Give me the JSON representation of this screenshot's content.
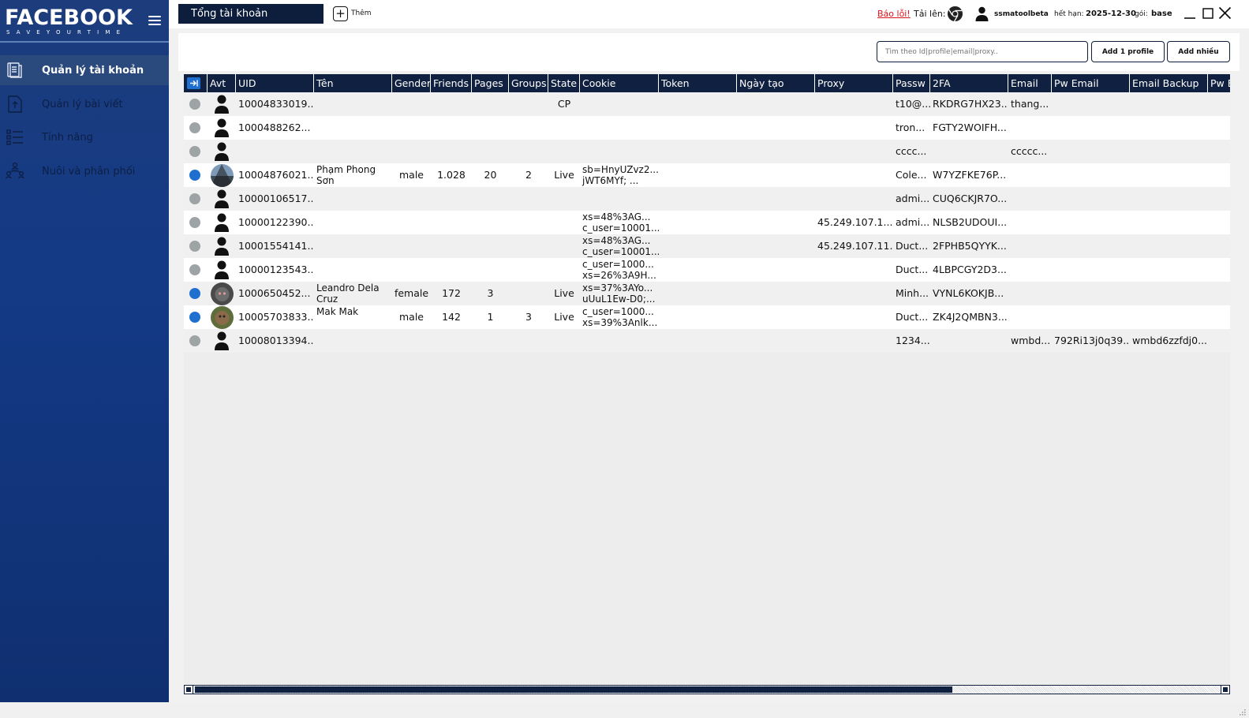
{
  "app": {
    "logo_word": "FACEBOOK",
    "logo_tagline": "SAVEYOURTIME"
  },
  "sidebar": {
    "items": [
      {
        "label": "Quản lý tài khoản",
        "icon": "book-stack-icon",
        "active": true
      },
      {
        "label": "Quản lý bài viết",
        "icon": "upload-document-icon",
        "active": false
      },
      {
        "label": "Tính năng",
        "icon": "checklist-icon",
        "active": false
      },
      {
        "label": "Nuôi và phân phối",
        "icon": "network-people-icon",
        "active": false
      }
    ]
  },
  "topbar": {
    "account_select": "Tổng tài khoản",
    "add_label": "Thêm",
    "report_label": "Báo lỗi!",
    "upload_label": "Tải lên:",
    "username": "ssmatoolbeta",
    "expiry_label": "hết hạn:",
    "expiry_value": "2025-12-30",
    "plan_label": "gói:",
    "plan_value": "base"
  },
  "toolbar": {
    "search_placeholder": "Tìm theo Id|profile|email|proxy..",
    "add_one_label": "Add 1 profile",
    "add_many_label": "Add nhiều"
  },
  "table": {
    "columns": [
      "Avt",
      "UID",
      "Tên",
      "Gender",
      "Friends",
      "Pages",
      "Groups",
      "State",
      "Cookie",
      "Token",
      "Ngày tạo",
      "Proxy",
      "Passw",
      "2FA",
      "Email",
      "Pw Email",
      "Email Backup",
      "Pw E"
    ],
    "rows": [
      {
        "status": "gray",
        "avatar": "default",
        "uid": "10004833019...",
        "name": "",
        "gender": "",
        "friends": "",
        "pages": "",
        "groups": "",
        "state": "CP",
        "cookie": "",
        "token": "",
        "created": "",
        "proxy": "",
        "password": "t10@...",
        "twofa": "RKDRG7HX23...",
        "email": "thang...",
        "pw_email": "",
        "email_backup": "",
        "pw_email_backup": ""
      },
      {
        "status": "gray",
        "avatar": "default",
        "uid": "1000488262...",
        "name": "",
        "gender": "",
        "friends": "",
        "pages": "",
        "groups": "",
        "state": "",
        "cookie": "",
        "token": "",
        "created": "",
        "proxy": "",
        "password": "tron...",
        "twofa": "FGTY2WOIFH...",
        "email": "",
        "pw_email": "",
        "email_backup": "",
        "pw_email_backup": ""
      },
      {
        "status": "gray",
        "avatar": "default",
        "uid": "",
        "name": "",
        "gender": "",
        "friends": "",
        "pages": "",
        "groups": "",
        "state": "",
        "cookie": "",
        "token": "",
        "created": "",
        "proxy": "",
        "password": "cccc...",
        "twofa": "",
        "email": "ccccc...",
        "pw_email": "",
        "email_backup": "",
        "pw_email_backup": ""
      },
      {
        "status": "blue",
        "avatar": "photo-sky",
        "uid": "10004876021...",
        "name": "Phạm Phong Sơn",
        "gender": "male",
        "friends": "1.028",
        "pages": "20",
        "groups": "2",
        "state": "Live",
        "cookie": "sb=HnyUZvz2... jWT6MYf; ...",
        "token": "",
        "created": "",
        "proxy": "",
        "password": "Cole...",
        "twofa": "W7YZFKE76P...",
        "email": "",
        "pw_email": "",
        "email_backup": "",
        "pw_email_backup": ""
      },
      {
        "status": "gray",
        "avatar": "default",
        "uid": "10000106517...",
        "name": "",
        "gender": "",
        "friends": "",
        "pages": "",
        "groups": "",
        "state": "",
        "cookie": "",
        "token": "",
        "created": "",
        "proxy": "",
        "password": "admi...",
        "twofa": "CUQ6CKJR7O...",
        "email": "",
        "pw_email": "",
        "email_backup": "",
        "pw_email_backup": ""
      },
      {
        "status": "gray",
        "avatar": "default",
        "uid": "10000122390...",
        "name": "",
        "gender": "",
        "friends": "",
        "pages": "",
        "groups": "",
        "state": "",
        "cookie": "xs=48%3AG... c_user=10001...",
        "token": "",
        "created": "",
        "proxy": "45.249.107.1...",
        "password": "admi...",
        "twofa": "NLSB2UDOUI...",
        "email": "",
        "pw_email": "",
        "email_backup": "",
        "pw_email_backup": ""
      },
      {
        "status": "gray",
        "avatar": "default",
        "uid": "10001554141...",
        "name": "",
        "gender": "",
        "friends": "",
        "pages": "",
        "groups": "",
        "state": "",
        "cookie": "xs=48%3AG... c_user=10001...",
        "token": "",
        "created": "",
        "proxy": "45.249.107.11...",
        "password": "Duct...",
        "twofa": "2FPHB5QYYK...",
        "email": "",
        "pw_email": "",
        "email_backup": "",
        "pw_email_backup": ""
      },
      {
        "status": "gray",
        "avatar": "default",
        "uid": "10000123543...",
        "name": "",
        "gender": "",
        "friends": "",
        "pages": "",
        "groups": "",
        "state": "",
        "cookie": "c_user=1000... xs=26%3A9H...",
        "token": "",
        "created": "",
        "proxy": "",
        "password": "Duct...",
        "twofa": "4LBPCGY2D3...",
        "email": "",
        "pw_email": "",
        "email_backup": "",
        "pw_email_backup": ""
      },
      {
        "status": "blue",
        "avatar": "photo-cat",
        "uid": "1000650452...",
        "name": "Leandro Dela Cruz",
        "gender": "female",
        "friends": "172",
        "pages": "3",
        "groups": "",
        "state": "Live",
        "cookie": "xs=37%3AYo... uUuL1Ew-D0;...",
        "token": "",
        "created": "",
        "proxy": "",
        "password": "Minh...",
        "twofa": "VYNL6KOKJB...",
        "email": "",
        "pw_email": "",
        "email_backup": "",
        "pw_email_backup": ""
      },
      {
        "status": "blue",
        "avatar": "photo-dog",
        "uid": "10005703833...",
        "name": "Mak Mak",
        "gender": "male",
        "friends": "142",
        "pages": "1",
        "groups": "3",
        "state": "Live",
        "cookie": "c_user=1000... xs=39%3Anlk...",
        "token": "",
        "created": "",
        "proxy": "",
        "password": "Duct...",
        "twofa": "ZK4J2QMBN3...",
        "email": "",
        "pw_email": "",
        "email_backup": "",
        "pw_email_backup": ""
      },
      {
        "status": "gray",
        "avatar": "default",
        "uid": "10008013394...",
        "name": "",
        "gender": "",
        "friends": "",
        "pages": "",
        "groups": "",
        "state": "",
        "cookie": "",
        "token": "",
        "created": "",
        "proxy": "",
        "password": "1234...",
        "twofa": "",
        "email": "wmbd...",
        "pw_email": "792Ri13j0q39...",
        "email_backup": "wmbd6zzfdj0...",
        "pw_email_backup": ""
      }
    ]
  },
  "colors": {
    "sidebar_bg": "#143a86",
    "header_bg": "#102040",
    "status_blue": "#1f6fd1",
    "status_gray": "#9ea3a6",
    "report_red": "#d9141b"
  }
}
